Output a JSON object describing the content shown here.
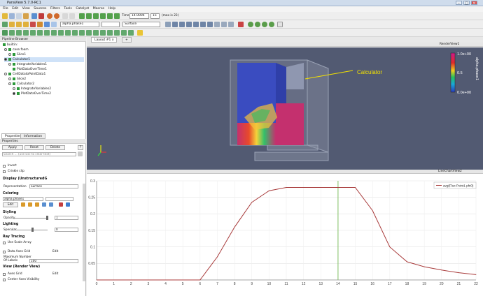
{
  "window": {
    "title": "ParaView 5.7.0-RC1",
    "min": "–",
    "max": "□",
    "close": "✕"
  },
  "menu": [
    "File",
    "Edit",
    "View",
    "Sources",
    "Filters",
    "Tools",
    "Catalyst",
    "Macros",
    "Help"
  ],
  "toolbar": {
    "time_label": "Time:",
    "time_value": "14.0004",
    "step_value": "15",
    "max_label": "(max is 23)",
    "array_value": "alpha.phase1",
    "repr_value": "Surface"
  },
  "pipeline": {
    "title": "Pipeline Browser",
    "items": [
      "builtin:",
      "case.foam",
      "Slice1",
      "Calculator1",
      "IntegrateVariables1",
      "PlotDataOverTime1",
      "CellDatatoPointData1",
      "Slice2",
      "Calculator2",
      "IntegrateVariables2",
      "PlotDataOverTime2"
    ]
  },
  "tabs": {
    "properties": "Properties",
    "information": "Information"
  },
  "props": {
    "header": "Properties",
    "apply": "Apply",
    "reset": "Reset",
    "delete": "Delete",
    "help": "?",
    "search_placeholder": "Search ... (use Esc to clear text)",
    "invert": "Invert",
    "crinkle": "Crinkle clip",
    "display_section": "Display (UnstructuredG",
    "representation_label": "Representation",
    "representation_value": "Surface",
    "coloring_section": "Coloring",
    "coloring_value": "alpha.phase1",
    "edit": "Edit",
    "styling_section": "Styling",
    "opacity_label": "Opacity",
    "opacity_value": "1",
    "lighting_section": "Lighting",
    "specular_label": "Specular",
    "specular_value": "0",
    "raytracing_section": "Ray Tracing",
    "scalar_array": "Use Scale Array",
    "data_axes_grid": "Data Axes Grid",
    "max_labels_label": "Maximum Number Of Labels",
    "max_labels_value": "100",
    "view_section": "View (Render View)",
    "axes_grid": "Axes Grid",
    "center_axes": "Center Axes Visibility"
  },
  "layout": {
    "tab": "Layout #1",
    "close": "x",
    "plus": "+"
  },
  "render": {
    "title": "RenderView1",
    "annotation": "Calculator",
    "colorbar": {
      "title": "alpha.phase1",
      "max": "1.0e+00",
      "mid": "0.5",
      "min": "0.0e+00"
    },
    "colors": {
      "background": "#525a72",
      "low": "#3a4cc0",
      "high": "#c0306f"
    }
  },
  "chart_view_title": "LineChartView2",
  "chart_data": {
    "type": "line",
    "series": [
      {
        "name": "avg(Flux Point1 phi0)",
        "color": "#a83a3a",
        "x": [
          0,
          1,
          2,
          3,
          4,
          5,
          6,
          7,
          8,
          9,
          10,
          11,
          12,
          13,
          14,
          15,
          16,
          17,
          18,
          19,
          20,
          21,
          22
        ],
        "y": [
          0,
          0,
          0,
          0,
          0,
          0,
          0,
          0.07,
          0.16,
          0.235,
          0.27,
          0.28,
          0.28,
          0.28,
          0.28,
          0.28,
          0.21,
          0.1,
          0.055,
          0.04,
          0.03,
          0.022,
          0.016
        ]
      }
    ],
    "xlim": [
      0,
      22
    ],
    "ylim": [
      0,
      0.3
    ],
    "xticks": [
      0,
      1,
      2,
      3,
      4,
      5,
      6,
      7,
      8,
      9,
      10,
      11,
      12,
      13,
      14,
      15,
      16,
      17,
      18,
      19,
      20,
      21,
      22
    ],
    "yticks": [
      0.05,
      0.1,
      0.15,
      0.2,
      0.25,
      0.3
    ],
    "ytick_labels": [
      "0.05",
      "0.1",
      "0.15",
      "0.2",
      "0.25",
      "0.3"
    ],
    "time_marker": 14,
    "marker_color": "#7fbf60",
    "grid": true,
    "legend": "top-right"
  }
}
